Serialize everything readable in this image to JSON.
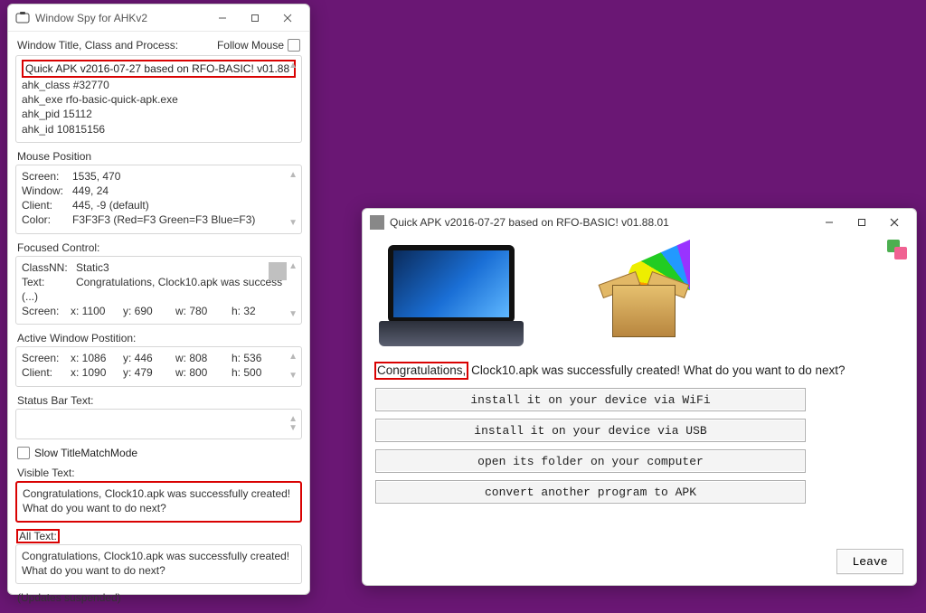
{
  "spy": {
    "title": "Window Spy for AHKv2",
    "header": {
      "label": "Window Title, Class and Process:",
      "followMouse": "Follow Mouse"
    },
    "titleBox": {
      "winTitle": "Quick APK v2016-07-27 based on RFO-BASIC! v01.88",
      "lines": [
        "ahk_class #32770",
        "ahk_exe rfo-basic-quick-apk.exe",
        "ahk_pid 15112",
        "ahk_id 10815156"
      ]
    },
    "mousePos": {
      "label": "Mouse Position",
      "rows": {
        "screenLabel": "Screen:",
        "screen": "1535, 470",
        "windowLabel": "Window:",
        "window": "449, 24",
        "clientLabel": "Client:",
        "client": "445, -9 (default)",
        "colorLabel": "Color:",
        "color": "F3F3F3 (Red=F3 Green=F3 Blue=F3)"
      }
    },
    "focused": {
      "label": "Focused Control:",
      "classNNLabel": "ClassNN:",
      "classNN": "Static3",
      "textLabel": "Text:",
      "text": "Congratulations, Clock10.apk was success",
      "ell": "(...)",
      "screenLabel": "Screen:",
      "x": "x: 1100",
      "y": "y: 690",
      "w": "w: 780",
      "h": "h: 32"
    },
    "activeWin": {
      "label": "Active Window Postition:",
      "row1": {
        "lab": "Screen:",
        "x": "x: 1086",
        "y": "y: 446",
        "w": "w: 808",
        "h": "h: 536"
      },
      "row2": {
        "lab": "Client:",
        "x": "x: 1090",
        "y": "y: 479",
        "w": "w: 800",
        "h": "h: 500"
      }
    },
    "statusBar": {
      "label": "Status Bar Text:"
    },
    "slowMode": "Slow TitleMatchMode",
    "visibleText": {
      "label": "Visible Text:",
      "content": "Congratulations, Clock10.apk was successfully created! What do you want to do next?"
    },
    "allText": {
      "label": "All Text:",
      "content": "Congratulations, Clock10.apk was successfully created! What do you want to do next?"
    },
    "footer": "(Updates suspended)"
  },
  "qapk": {
    "title": "Quick APK v2016-07-27 based on RFO-BASIC! v01.88.01",
    "message": {
      "congr": "Congratulations,",
      "rest": " Clock10.apk was successfully created! What do you want to do next?"
    },
    "buttons": {
      "wifi": "install it on your device via WiFi",
      "usb": "install it on your device via USB",
      "folder": "open its folder on your computer",
      "convert": "convert another program to APK"
    },
    "leave": "Leave"
  }
}
